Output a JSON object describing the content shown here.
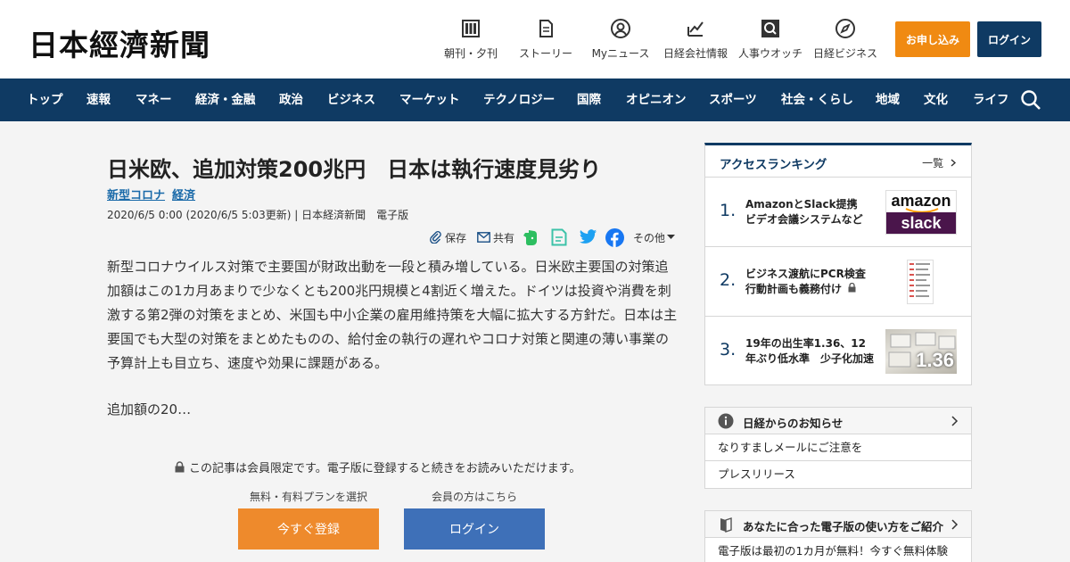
{
  "header": {
    "logo": "日本經濟新聞",
    "utilities": [
      {
        "label": "朝刊・夕刊",
        "icon": "newspaper-icon"
      },
      {
        "label": "ストーリー",
        "icon": "document-icon"
      },
      {
        "label": "Myニュース",
        "icon": "person-icon"
      },
      {
        "label": "日経会社情報",
        "icon": "chart-pen-icon"
      },
      {
        "label": "人事ウオッチ",
        "icon": "magnifier-icon"
      },
      {
        "label": "日経ビジネス",
        "icon": "compass-icon"
      }
    ],
    "apply_label": "お申し込み",
    "login_label": "ログイン"
  },
  "nav": {
    "items": [
      "トップ",
      "速報",
      "マネー",
      "経済・金融",
      "政治",
      "ビジネス",
      "マーケット",
      "テクノロジー",
      "国際",
      "オピニオン",
      "スポーツ",
      "社会・くらし",
      "地域",
      "文化",
      "ライフ"
    ]
  },
  "article": {
    "title": "日米欧、追加対策200兆円　日本は執行速度見劣り",
    "tags": [
      "新型コロナ",
      "経済"
    ],
    "meta": "2020/6/5 0:00 (2020/6/5 5:03更新) | 日本経済新聞　電子版",
    "share": {
      "save": "保存",
      "share": "共有",
      "more": "その他"
    },
    "body": "新型コロナウイルス対策で主要国が財政出動を一段と積み増している。日米欧主要国の対策追加額はこの1カ月あまりで少なくとも200兆円規模と4割近く増えた。ドイツは投資や消費を刺激する第2弾の対策をまとめ、米国も中小企業の雇用維持策を大幅に拡大する方針だ。日本は主要国でも大型の対策をまとめたものの、給付金の執行の遅れやコロナ対策と関連の薄い事業の予算計上も目立ち、速度や効果に課題がある。",
    "continuation": "追加額の20…",
    "paywall_note": "この記事は会員限定です。電子版に登録すると続きをお読みいただけます。",
    "plan_label": "無料・有料プランを選択",
    "member_label": "会員の方はこちら",
    "register_label": "今すぐ登録",
    "login_label": "ログイン"
  },
  "ranking": {
    "title": "アクセスランキング",
    "all_label": "一覧",
    "items": [
      {
        "num": "1.",
        "text": "AmazonとSlack提携　ビデオ会議システムなど",
        "locked": false
      },
      {
        "num": "2.",
        "text": "ビジネス渡航にPCR検査 行動計画も義務付け",
        "locked": true
      },
      {
        "num": "3.",
        "text": "19年の出生率1.36、12年ぶり低水準　少子化加速",
        "locked": false
      }
    ],
    "thumb1_top": "amazon",
    "thumb1_bottom": "slack",
    "thumb3_text": "1.36"
  },
  "notices": {
    "title": "日経からのお知らせ",
    "rows": [
      "なりすましメールにご注意を",
      "プレスリリース"
    ]
  },
  "guide": {
    "title": "あなたに合った電子版の使い方をご紹介",
    "rows": [
      "電子版は最初の1カ月が無料！今すぐ無料体験"
    ]
  },
  "colors": {
    "navy": "#0f3a63",
    "orange": "#f08a12",
    "link": "#1a6aa9",
    "login_blue": "#3e70b8"
  }
}
